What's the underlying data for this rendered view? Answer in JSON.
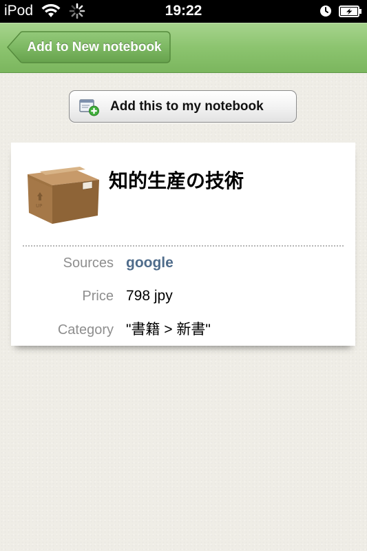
{
  "status_bar": {
    "carrier": "iPod",
    "time": "19:22",
    "icons": [
      "wifi-icon",
      "activity-spinner-icon",
      "clock-icon",
      "battery-charging-icon"
    ]
  },
  "nav_bar": {
    "back_label": "Add to New notebook",
    "color": "#8cc46f"
  },
  "actions": {
    "add_label": "Add this to my notebook",
    "add_icon": "add-to-notebook-icon"
  },
  "item": {
    "title": "知的生産の技術",
    "image_icon": "cardboard-box-icon",
    "fields": [
      {
        "label": "Sources",
        "value": "google"
      },
      {
        "label": "Price",
        "value": "798 jpy"
      },
      {
        "label": "Category",
        "value": "\"書籍 > 新書\""
      }
    ]
  },
  "colors": {
    "link": "#4f6c8b",
    "label_gray": "#8e8e8e",
    "nav_green": "#8cc46f"
  }
}
